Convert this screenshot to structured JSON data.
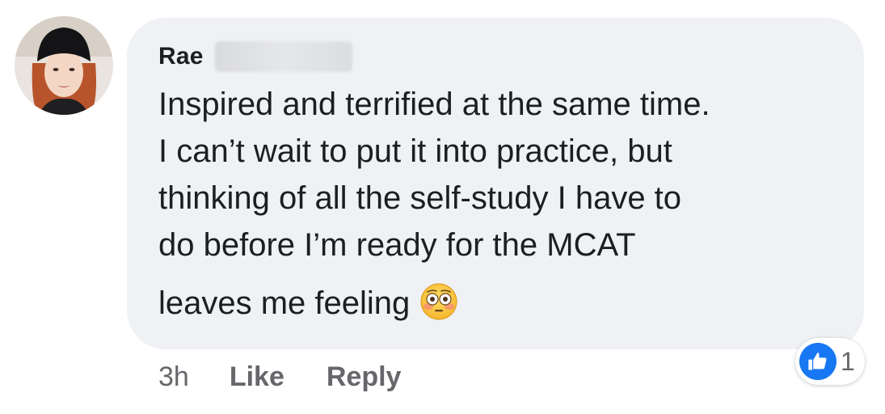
{
  "comment": {
    "author_name": "Rae",
    "text_lines": [
      "Inspired and terrified at the same time.",
      "I can’t wait to put it into practice, but",
      "thinking of all the self-study I have to",
      "do before I’m ready for the MCAT",
      "leaves me feeling"
    ],
    "emoji": "flushed-face-icon",
    "timestamp": "3h",
    "like_label": "Like",
    "reply_label": "Reply",
    "reactions": {
      "icon": "thumbs-up-icon",
      "count": "1"
    }
  },
  "colors": {
    "bubble": "#eff1f4",
    "text": "#1c1e21",
    "secondary_text": "#65676b",
    "like_blue": "#1877f2"
  }
}
